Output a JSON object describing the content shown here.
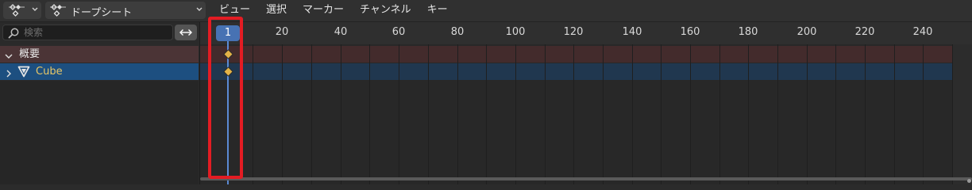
{
  "header": {
    "editor_type_icon": "dopesheet-icon",
    "mode_select": {
      "label": "ドープシート",
      "icon": "dopesheet-icon"
    },
    "menu": [
      "ビュー",
      "選択",
      "マーカー",
      "チャンネル",
      "キー"
    ]
  },
  "channels": {
    "search": {
      "placeholder": "検索",
      "value": ""
    },
    "swap_icon": "swap-arrows-icon",
    "rows": [
      {
        "label": "概要",
        "expanded": true
      },
      {
        "label": "Cube",
        "icon": "object-data-icon",
        "expanded": false
      }
    ]
  },
  "timeline": {
    "current_frame": "1",
    "tick_labels": [
      "20",
      "40",
      "60",
      "80",
      "100",
      "120",
      "140",
      "160",
      "180",
      "200",
      "220",
      "240"
    ],
    "keyframes": [
      {
        "channel": "概要",
        "frame": 1
      },
      {
        "channel": "Cube",
        "frame": 1
      }
    ]
  },
  "colors": {
    "accent": "#4772b3",
    "summary_row": "#4b3436",
    "selected_row": "#1d4f80",
    "keyframe": "#e3b347",
    "highlight": "#e31c23"
  }
}
